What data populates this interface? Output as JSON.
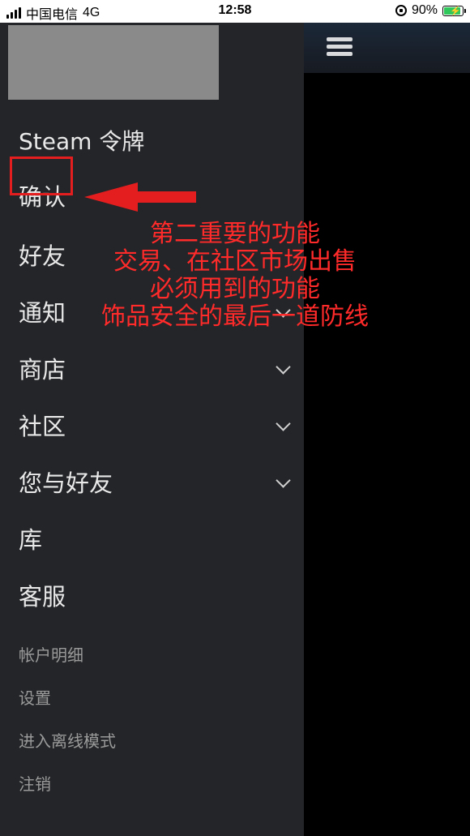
{
  "status_bar": {
    "carrier": "中国电信",
    "network": "4G",
    "time": "12:58",
    "battery": "90%",
    "battery_level": 0.9
  },
  "drawer": {
    "steam_guard": "Steam 令牌",
    "confirm": "确认",
    "friends": "好友",
    "notifications": "通知",
    "store": "商店",
    "community": "社区",
    "you_and_friends": "您与好友",
    "library": "库",
    "support": "客服",
    "account_details": "帐户明细",
    "settings": "设置",
    "offline_mode": "进入离线模式",
    "logout": "注销"
  },
  "annotation": {
    "line1": "第二重要的功能",
    "line2": "交易、在社区市场出售",
    "line3": "必须用到的功能",
    "line4": "饰品安全的最后一道防线",
    "color": "#ff2a2a"
  },
  "colors": {
    "drawer_bg": "#232528",
    "header_bg": "#1b2838",
    "highlight": "#e41e1e"
  }
}
